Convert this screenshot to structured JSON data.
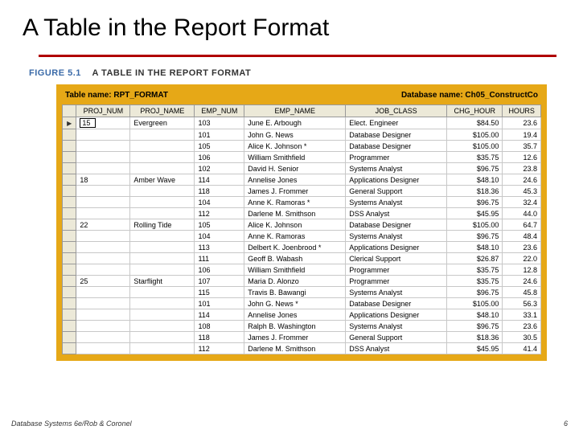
{
  "title": "A Table in the Report Format",
  "figure": {
    "label": "FIGURE 5.1",
    "caption": "A TABLE IN THE REPORT FORMAT"
  },
  "meta": {
    "table_label": "Table name: RPT_FORMAT",
    "db_label": "Database name: Ch05_ConstructCo"
  },
  "columns": [
    "PROJ_NUM",
    "PROJ_NAME",
    "EMP_NUM",
    "EMP_NAME",
    "JOB_CLASS",
    "CHG_HOUR",
    "HOURS"
  ],
  "current": "15",
  "rows": [
    {
      "sel": "▶",
      "proj": "",
      "pname": "Evergreen",
      "emp": "103",
      "ename": "June E. Arbough",
      "job": "Elect. Engineer",
      "chg": "$84.50",
      "hrs": "23.6"
    },
    {
      "sel": "",
      "proj": "",
      "pname": "",
      "emp": "101",
      "ename": "John G. News",
      "job": "Database Designer",
      "chg": "$105.00",
      "hrs": "19.4"
    },
    {
      "sel": "",
      "proj": "",
      "pname": "",
      "emp": "105",
      "ename": "Alice K. Johnson *",
      "job": "Database Designer",
      "chg": "$105.00",
      "hrs": "35.7"
    },
    {
      "sel": "",
      "proj": "",
      "pname": "",
      "emp": "106",
      "ename": "William Smithfield",
      "job": "Programmer",
      "chg": "$35.75",
      "hrs": "12.6"
    },
    {
      "sel": "",
      "proj": "",
      "pname": "",
      "emp": "102",
      "ename": "David H. Senior",
      "job": "Systems Analyst",
      "chg": "$96.75",
      "hrs": "23.8"
    },
    {
      "sel": "",
      "proj": "18",
      "pname": "Amber Wave",
      "emp": "114",
      "ename": "Annelise Jones",
      "job": "Applications Designer",
      "chg": "$48.10",
      "hrs": "24.6"
    },
    {
      "sel": "",
      "proj": "",
      "pname": "",
      "emp": "118",
      "ename": "James J. Frommer",
      "job": "General Support",
      "chg": "$18.36",
      "hrs": "45.3"
    },
    {
      "sel": "",
      "proj": "",
      "pname": "",
      "emp": "104",
      "ename": "Anne K. Ramoras *",
      "job": "Systems Analyst",
      "chg": "$96.75",
      "hrs": "32.4"
    },
    {
      "sel": "",
      "proj": "",
      "pname": "",
      "emp": "112",
      "ename": "Darlene M. Smithson",
      "job": "DSS Analyst",
      "chg": "$45.95",
      "hrs": "44.0"
    },
    {
      "sel": "",
      "proj": "22",
      "pname": "Rolling Tide",
      "emp": "105",
      "ename": "Alice K. Johnson",
      "job": "Database Designer",
      "chg": "$105.00",
      "hrs": "64.7"
    },
    {
      "sel": "",
      "proj": "",
      "pname": "",
      "emp": "104",
      "ename": "Anne K. Ramoras",
      "job": "Systems Analyst",
      "chg": "$96.75",
      "hrs": "48.4"
    },
    {
      "sel": "",
      "proj": "",
      "pname": "",
      "emp": "113",
      "ename": "Delbert K. Joenbrood *",
      "job": "Applications Designer",
      "chg": "$48.10",
      "hrs": "23.6"
    },
    {
      "sel": "",
      "proj": "",
      "pname": "",
      "emp": "111",
      "ename": "Geoff B. Wabash",
      "job": "Clerical Support",
      "chg": "$26.87",
      "hrs": "22.0"
    },
    {
      "sel": "",
      "proj": "",
      "pname": "",
      "emp": "106",
      "ename": "William Smithfield",
      "job": "Programmer",
      "chg": "$35.75",
      "hrs": "12.8"
    },
    {
      "sel": "",
      "proj": "25",
      "pname": "Starflight",
      "emp": "107",
      "ename": "Maria D. Alonzo",
      "job": "Programmer",
      "chg": "$35.75",
      "hrs": "24.6"
    },
    {
      "sel": "",
      "proj": "",
      "pname": "",
      "emp": "115",
      "ename": "Travis B. Bawangi",
      "job": "Systems Analyst",
      "chg": "$96.75",
      "hrs": "45.8"
    },
    {
      "sel": "",
      "proj": "",
      "pname": "",
      "emp": "101",
      "ename": "John G. News *",
      "job": "Database Designer",
      "chg": "$105.00",
      "hrs": "56.3"
    },
    {
      "sel": "",
      "proj": "",
      "pname": "",
      "emp": "114",
      "ename": "Annelise Jones",
      "job": "Applications Designer",
      "chg": "$48.10",
      "hrs": "33.1"
    },
    {
      "sel": "",
      "proj": "",
      "pname": "",
      "emp": "108",
      "ename": "Ralph B. Washington",
      "job": "Systems Analyst",
      "chg": "$96.75",
      "hrs": "23.6"
    },
    {
      "sel": "",
      "proj": "",
      "pname": "",
      "emp": "118",
      "ename": "James J. Frommer",
      "job": "General Support",
      "chg": "$18.36",
      "hrs": "30.5"
    },
    {
      "sel": "",
      "proj": "",
      "pname": "",
      "emp": "112",
      "ename": "Darlene M. Smithson",
      "job": "DSS Analyst",
      "chg": "$45.95",
      "hrs": "41.4"
    }
  ],
  "footer": {
    "left": "Database Systems 6e/Rob & Coronel",
    "right": "6"
  }
}
